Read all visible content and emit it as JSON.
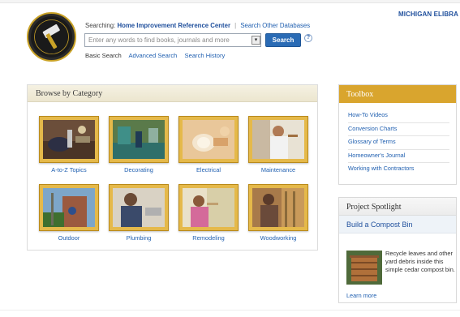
{
  "header": {
    "logo_text": "Home Improvement Reference Center",
    "library_name": "MICHIGAN ELIBRA",
    "searching_label": "Searching:",
    "database_name": "Home Improvement Reference Center",
    "search_other_label": "Search Other Databases",
    "search_placeholder": "Enter any words to find books, journals and more",
    "search_button": "Search",
    "help_symbol": "?",
    "dropdown_symbol": "▾",
    "subnav": {
      "basic": "Basic Search",
      "advanced": "Advanced Search",
      "history": "Search History"
    }
  },
  "browse": {
    "title": "Browse by Category",
    "categories": [
      {
        "label": "A-to-Z Topics",
        "icon": "toolbelt-photo"
      },
      {
        "label": "Decorating",
        "icon": "living-room-photo"
      },
      {
        "label": "Electrical",
        "icon": "lightbulb-photo"
      },
      {
        "label": "Maintenance",
        "icon": "man-painting-photo"
      },
      {
        "label": "Outdoor",
        "icon": "brick-house-photo"
      },
      {
        "label": "Plumbing",
        "icon": "plumber-photo"
      },
      {
        "label": "Remodeling",
        "icon": "woman-wallpaper-photo"
      },
      {
        "label": "Woodworking",
        "icon": "woodworker-photo"
      }
    ]
  },
  "toolbox": {
    "title": "Toolbox",
    "items": [
      "How-To Videos",
      "Conversion Charts",
      "Glossary of Terms",
      "Homeowner's Journal",
      "Working with Contractors"
    ]
  },
  "spotlight": {
    "title": "Project Spotlight",
    "subtitle": "Build a Compost Bin",
    "body": "Recycle leaves and other yard debris inside this simple cedar compost bin.",
    "more": "Learn more"
  },
  "colors": {
    "link": "#1f5fb0",
    "toolbox_header": "#d9a52e",
    "frame_gold": "#e5b94a",
    "search_button": "#2a6bb5"
  }
}
